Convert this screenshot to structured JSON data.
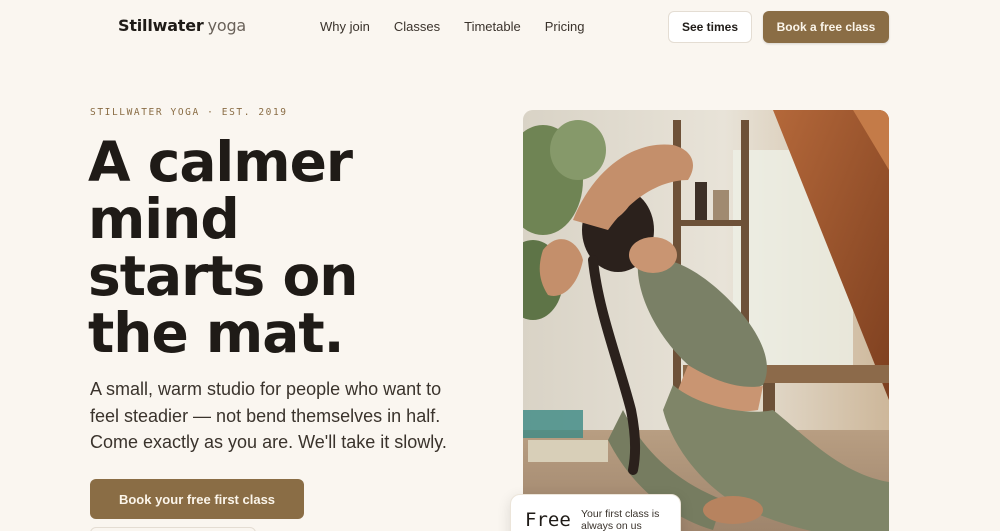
{
  "brand": {
    "name_strong": "Stillwater",
    "name_light": "yoga"
  },
  "nav": {
    "items": [
      {
        "label": "Why join"
      },
      {
        "label": "Classes"
      },
      {
        "label": "Timetable"
      },
      {
        "label": "Pricing"
      }
    ]
  },
  "header_actions": {
    "see_times_label": "See times",
    "book_free_label": "Book a free class"
  },
  "hero": {
    "eyebrow": "STILLWATER YOGA · EST. 2019",
    "headline_lines": [
      "A calmer",
      "mind",
      "starts on",
      "the mat."
    ],
    "lede_lines": [
      "A small, warm studio for people who want to",
      "feel steadier — not bend themselves in half.",
      "Come exactly as you are. We'll take it slowly."
    ],
    "cta_label": "Book your free first class"
  },
  "offer_card": {
    "title": "Free",
    "text": "Your first class is always on us"
  },
  "colors": {
    "background": "#faf6f0",
    "accent": "#8a6d45",
    "text": "#1f1b17"
  }
}
